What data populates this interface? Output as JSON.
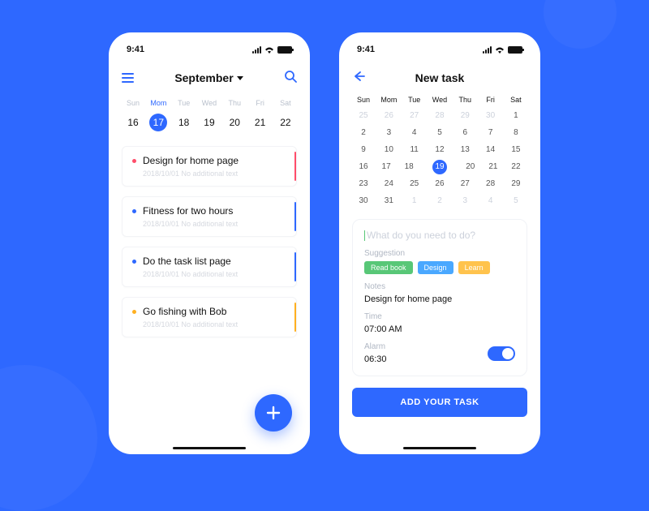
{
  "statusbar": {
    "time": "9:41"
  },
  "screen1": {
    "title": "September",
    "week": {
      "labels": [
        "Sun",
        "Mom",
        "Tue",
        "Wed",
        "Thu",
        "Fri",
        "Sat"
      ],
      "dates": [
        16,
        17,
        18,
        19,
        20,
        21,
        22
      ],
      "selected_index": 1
    },
    "tasks": [
      {
        "title": "Design for home page",
        "meta": "2018/10/01  No additional text",
        "color": "red"
      },
      {
        "title": "Fitness for two hours",
        "meta": "2018/10/01  No additional text",
        "color": "blue"
      },
      {
        "title": "Do the task list page",
        "meta": "2018/10/01  No additional text",
        "color": "blue"
      },
      {
        "title": "Go fishing with Bob",
        "meta": "2018/10/01  No additional text",
        "color": "orange"
      }
    ]
  },
  "screen2": {
    "title": "New task",
    "week_labels": [
      "Sun",
      "Mom",
      "Tue",
      "Wed",
      "Thu",
      "Fri",
      "Sat"
    ],
    "month_rows": [
      {
        "days": [
          25,
          26,
          27,
          28,
          29,
          30,
          1
        ],
        "muted": [
          0,
          1,
          2,
          3,
          4,
          5
        ]
      },
      {
        "days": [
          2,
          3,
          4,
          5,
          6,
          7,
          8
        ],
        "muted": []
      },
      {
        "days": [
          9,
          10,
          11,
          12,
          13,
          14,
          15
        ],
        "muted": []
      },
      {
        "days": [
          16,
          17,
          18,
          19,
          20,
          21,
          22
        ],
        "muted": [],
        "selected": 3
      },
      {
        "days": [
          23,
          24,
          25,
          26,
          27,
          28,
          29
        ],
        "muted": []
      },
      {
        "days": [
          30,
          31,
          1,
          2,
          3,
          4,
          5
        ],
        "muted": [
          2,
          3,
          4,
          5,
          6
        ]
      }
    ],
    "form": {
      "placeholder": "What do you need to do?",
      "suggestion_label": "Suggestion",
      "tags": [
        {
          "label": "Read book",
          "color": "green"
        },
        {
          "label": "Design",
          "color": "blue"
        },
        {
          "label": "Learn",
          "color": "yellow"
        }
      ],
      "notes_label": "Notes",
      "notes_value": "Design for home page",
      "time_label": "Time",
      "time_value": "07:00 AM",
      "alarm_label": "Alarm",
      "alarm_value": "06:30",
      "submit": "ADD YOUR TASK"
    }
  }
}
